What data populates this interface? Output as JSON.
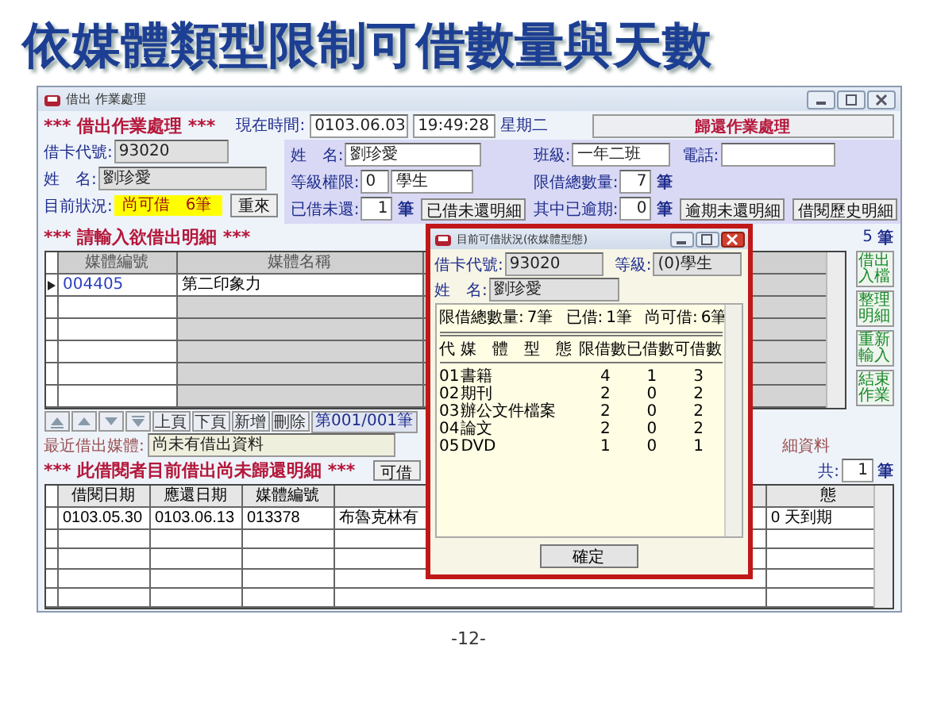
{
  "slide": {
    "title": "依媒體類型限制可借數量與天數",
    "page_number": "-12-"
  },
  "window": {
    "title": "借出 作業處理"
  },
  "header": {
    "heading": "*** 借出作業處理 ***",
    "time_label": "現在時間:",
    "date": "0103.06.03",
    "time": "19:49:28",
    "weekday": "星期二",
    "return_button": "歸還作業處理"
  },
  "borrower": {
    "card_label": "借卡代號:",
    "card_no": "93020",
    "name_label": "姓　名:",
    "name": "劉珍愛",
    "status_label": "目前狀況:",
    "status_value": "尚可借　6筆",
    "reset_button": "重來"
  },
  "info": {
    "name_label": "姓　名:",
    "name": "劉珍愛",
    "class_label": "班級:",
    "class": "一年二班",
    "phone_label": "電話:",
    "level_label": "等級權限:",
    "level_code": "0",
    "level_name": "學生",
    "limit_label": "限借總數量:",
    "limit": "7",
    "limit_unit": "筆",
    "borrowed_label": "已借未還:",
    "borrowed": "1",
    "borrowed_unit": "筆",
    "borrowed_button": "已借未還明細",
    "overdue_label": "其中已逾期:",
    "overdue": "0",
    "overdue_unit": "筆",
    "overdue_button": "逾期未還明細",
    "history_button": "借閱歷史明細"
  },
  "entry": {
    "heading": "*** 請輸入欲借出明細 ***",
    "count": "5",
    "count_unit": "筆",
    "columns": [
      "媒體編號",
      "媒體名稱"
    ],
    "rows": [
      {
        "cells": [
          "004405",
          "第二印象力"
        ],
        "current": true
      }
    ],
    "side_buttons": [
      "借出入檔",
      "整理明細",
      "重新輸入",
      "結束作業"
    ],
    "nav_buttons": [
      {
        "kind": "first"
      },
      {
        "kind": "prev"
      },
      {
        "kind": "next"
      },
      {
        "kind": "last"
      },
      {
        "kind": "text",
        "label": "上頁"
      },
      {
        "kind": "text",
        "label": "下頁"
      },
      {
        "kind": "text",
        "label": "新增"
      },
      {
        "kind": "text",
        "label": "刪除"
      }
    ],
    "record_indicator": "第001/001筆"
  },
  "recent": {
    "label": "最近借出媒體:",
    "value": "尚未有借出資料",
    "right_label": "細資料"
  },
  "outstanding": {
    "heading": "*** 此借閱者目前借出尚未歸還明細 ***",
    "button": "可借",
    "total_label": "共:",
    "total": "1",
    "total_unit": "筆",
    "columns": [
      "借閱日期",
      "應還日期",
      "媒體編號",
      "",
      "態"
    ],
    "rows": [
      {
        "cells": [
          "0103.05.30",
          "0103.06.13",
          "013378",
          "布魯克林有",
          "0 天到期"
        ]
      }
    ]
  },
  "dialog": {
    "title": "目前可借狀況(依媒體型態)",
    "card_label": "借卡代號:",
    "card_no": "93020",
    "level_label": "等級:",
    "level": "(0)學生",
    "name_label": "姓　名:",
    "name": "劉珍愛",
    "summary": [
      {
        "label": "限借總數量:",
        "value": "7筆"
      },
      {
        "label": "已借:",
        "value": "1筆"
      },
      {
        "label": "尚可借:",
        "value": "6筆"
      }
    ],
    "columns": [
      "代",
      "媒　體　型　態",
      "限借數",
      "已借數",
      "可借數"
    ],
    "rows": [
      [
        "01",
        "書籍",
        "4",
        "1",
        "3"
      ],
      [
        "02",
        "期刊",
        "2",
        "0",
        "2"
      ],
      [
        "03",
        "辦公文件檔案",
        "2",
        "0",
        "2"
      ],
      [
        "04",
        "論文",
        "2",
        "0",
        "2"
      ],
      [
        "05",
        "DVD",
        "1",
        "0",
        "1"
      ]
    ],
    "ok_button": "確定"
  }
}
